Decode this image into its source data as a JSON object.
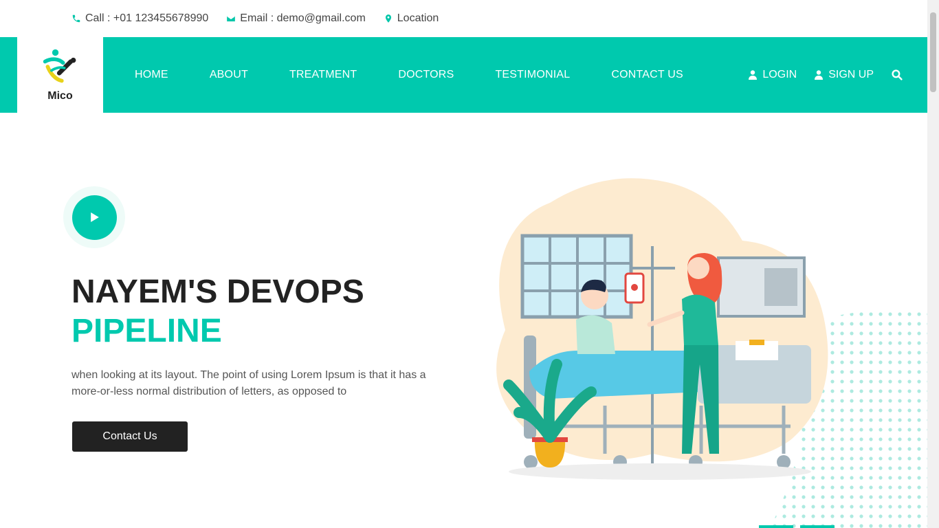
{
  "topbar": {
    "call": "Call : +01 123455678990",
    "email": "Email : demo@gmail.com",
    "location": "Location"
  },
  "brand": {
    "name": "Mico"
  },
  "nav": {
    "items": [
      {
        "label": "HOME"
      },
      {
        "label": "ABOUT"
      },
      {
        "label": "TREATMENT"
      },
      {
        "label": "DOCTORS"
      },
      {
        "label": "TESTIMONIAL"
      },
      {
        "label": "CONTACT US"
      }
    ],
    "login": "LOGIN",
    "signup": "SIGN UP"
  },
  "hero": {
    "title_line1": "NAYEM'S DEVOPS",
    "title_line2": "PIPELINE",
    "description": "when looking at its layout. The point of using Lorem Ipsum is that it has a more-or-less normal distribution of letters, as opposed to",
    "cta_label": "Contact Us"
  },
  "colors": {
    "accent": "#00c9ae",
    "dark": "#222222"
  },
  "icons": [
    "phone-icon",
    "envelope-icon",
    "map-marker-icon",
    "user-icon",
    "search-icon",
    "play-icon"
  ]
}
